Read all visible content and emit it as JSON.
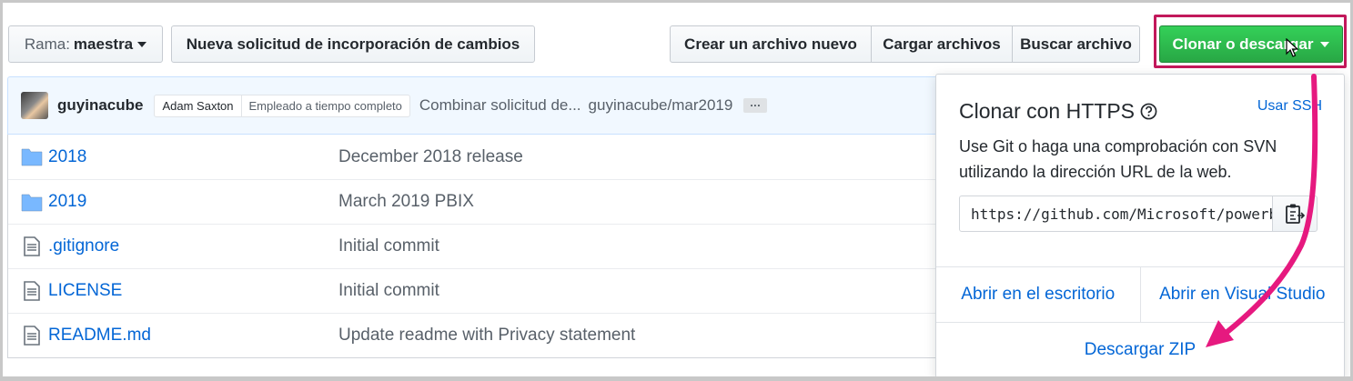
{
  "toolbar": {
    "branch_prefix": "Rama:",
    "branch_name": "maestra",
    "new_pr": "Nueva solicitud de incorporación de cambios",
    "create_file": "Crear un archivo nuevo",
    "upload_files": "Cargar archivos",
    "find_file": "Buscar archivo",
    "clone_download": "Clonar o descargar"
  },
  "commit": {
    "author": "guyinacube",
    "label_name": "Adam Saxton",
    "label_role": "Empleado a tiempo completo",
    "message": "Combinar solicitud de...",
    "branch": "guyinacube/mar2019",
    "more": "···"
  },
  "files": [
    {
      "icon": "folder-icon",
      "name": "2018",
      "message": "December 2018 release"
    },
    {
      "icon": "folder-icon",
      "name": "2019",
      "message": "March 2019 PBIX"
    },
    {
      "icon": "file-icon",
      "name": ".gitignore",
      "message": "Initial commit"
    },
    {
      "icon": "file-icon",
      "name": "LICENSE",
      "message": "Initial commit"
    },
    {
      "icon": "file-icon",
      "name": "README.md",
      "message": "Update readme with Privacy statement"
    }
  ],
  "popover": {
    "title": "Clonar con HTTPS",
    "use_ssh": "Usar SSH",
    "description": "Use Git o haga una comprobación con SVN utilizando la dirección URL de la web.",
    "url": "https://github.com/Microsoft/powerbi-desktop-samples.git",
    "open_desktop": "Abrir en el escritorio",
    "open_vs": "Abrir en Visual Studio",
    "download_zip": "Descargar ZIP"
  },
  "colors": {
    "annotation": "#e6197f",
    "highlight_border": "#c2185b",
    "clone_green": "#28a745",
    "link_blue": "#0366d6"
  }
}
